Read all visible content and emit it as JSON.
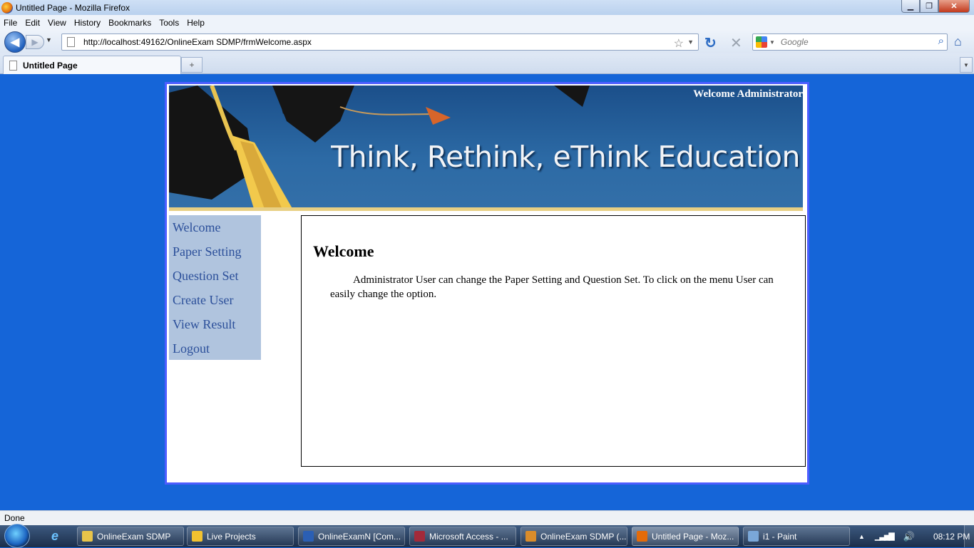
{
  "window": {
    "title": "Untitled Page - Mozilla Firefox",
    "minimize": "▁",
    "maximize": "❐",
    "close": "✕"
  },
  "menu": [
    "File",
    "Edit",
    "View",
    "History",
    "Bookmarks",
    "Tools",
    "Help"
  ],
  "navigation": {
    "back_icon": "◀",
    "forward_icon": "▶",
    "history_dropdown": "▼",
    "url": "http://localhost:49162/OnlineExam SDMP/frmWelcome.aspx",
    "bookmark_star": "☆",
    "url_dropdown": "▼",
    "reload_icon": "↻",
    "stop_icon": "✕",
    "search_engine_dropdown": "▼",
    "search_placeholder": "Google",
    "search_icon": "⌕",
    "home_icon": "⌂"
  },
  "tabs": {
    "active_label": "Untitled Page",
    "new_tab": "+",
    "list_all": "▼"
  },
  "page": {
    "banner": {
      "welcome_text": "Welcome Administrator",
      "headline": "Think, Rethink, eThink Education"
    },
    "sidebar": {
      "items": [
        {
          "label": "Welcome"
        },
        {
          "label": "Paper Setting"
        },
        {
          "label": "Question Set"
        },
        {
          "label": "Create User"
        },
        {
          "label": "View Result"
        },
        {
          "label": "Logout"
        }
      ]
    },
    "content": {
      "heading": "Welcome",
      "body": "Administrator User can change the Paper Setting and Question Set. To click on the menu User can easily change the option."
    }
  },
  "statusbar": {
    "text": "Done"
  },
  "taskbar": {
    "ie_icon": "e",
    "tasks": [
      {
        "label": "OnlineExam SDMP",
        "icon_color": "#e8c44a"
      },
      {
        "label": "Live Projects",
        "icon_color": "#f2c230"
      },
      {
        "label": "OnlineExamN [Com...",
        "icon_color": "#2b5fb4"
      },
      {
        "label": "Microsoft Access - ...",
        "icon_color": "#a32a3a"
      },
      {
        "label": "OnlineExam SDMP (...",
        "icon_color": "#d98c2b"
      },
      {
        "label": "Untitled Page - Moz...",
        "icon_color": "#e36b0a"
      },
      {
        "label": "i1 - Paint",
        "icon_color": "#7aa7d8"
      }
    ],
    "tray": {
      "show_hidden": "▲",
      "network": "▁▃▅▇",
      "volume": "🔊",
      "clock": "08:12 PM"
    }
  },
  "colors": {
    "page_background": "#1565d8",
    "page_border": "#4d5dff",
    "sidebar_background": "#b0c4de",
    "sidebar_link": "#2b4f9a",
    "banner_stripe": "#e8cf83"
  }
}
